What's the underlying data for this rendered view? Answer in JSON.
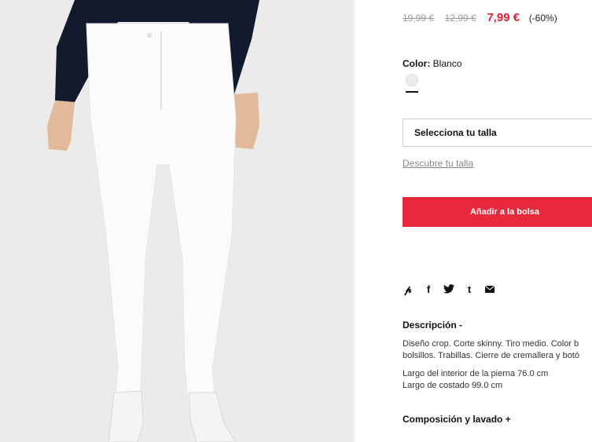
{
  "product": {
    "old_price_1": "19,99 €",
    "old_price_2": "12,99 €",
    "sale_price": "7,99 €",
    "discount": "(-60%)"
  },
  "color": {
    "label": "Color:",
    "value": "Blanco",
    "swatch_color": "#ececec"
  },
  "size": {
    "select_label": "Selecciona tu talla",
    "guide_link": "Descubre tu talla"
  },
  "cart": {
    "add_button": "Añadir a la bolsa",
    "button_color": "#e8293b"
  },
  "share": {
    "icons": [
      "pinterest-icon",
      "facebook-icon",
      "twitter-icon",
      "tumblr-icon",
      "mail-icon"
    ]
  },
  "description": {
    "title": "Descripción -",
    "line1": "Diseño crop. Corte skinny. Tiro medio. Color b",
    "line2": "bolsillos. Trabillas. Cierre de cremallera y botó",
    "measure1": "Largo del interior de la pierna 76.0 cm",
    "measure2": "Largo de costado 99.0 cm"
  },
  "composition": {
    "title": "Composición y lavado +"
  }
}
